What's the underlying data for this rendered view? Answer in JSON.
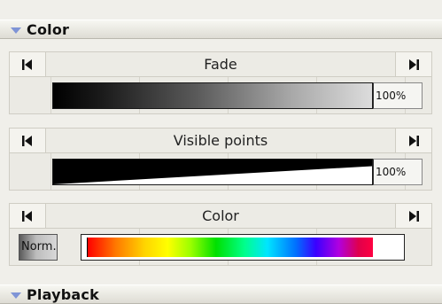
{
  "sections": {
    "color": {
      "title": "Color"
    },
    "playback": {
      "title": "Playback"
    }
  },
  "rows": [
    {
      "label": "Fade",
      "value_text": "100%",
      "value": 100
    },
    {
      "label": "Visible points",
      "value_text": "100%",
      "value": 100
    },
    {
      "label": "Color",
      "mode_text": "Norm."
    }
  ],
  "icons": {
    "prev": "skip-to-start-icon",
    "next": "skip-to-end-icon",
    "expand": "triangle-down-icon"
  },
  "colors": {
    "accent_triangle": "#7f94d6"
  }
}
